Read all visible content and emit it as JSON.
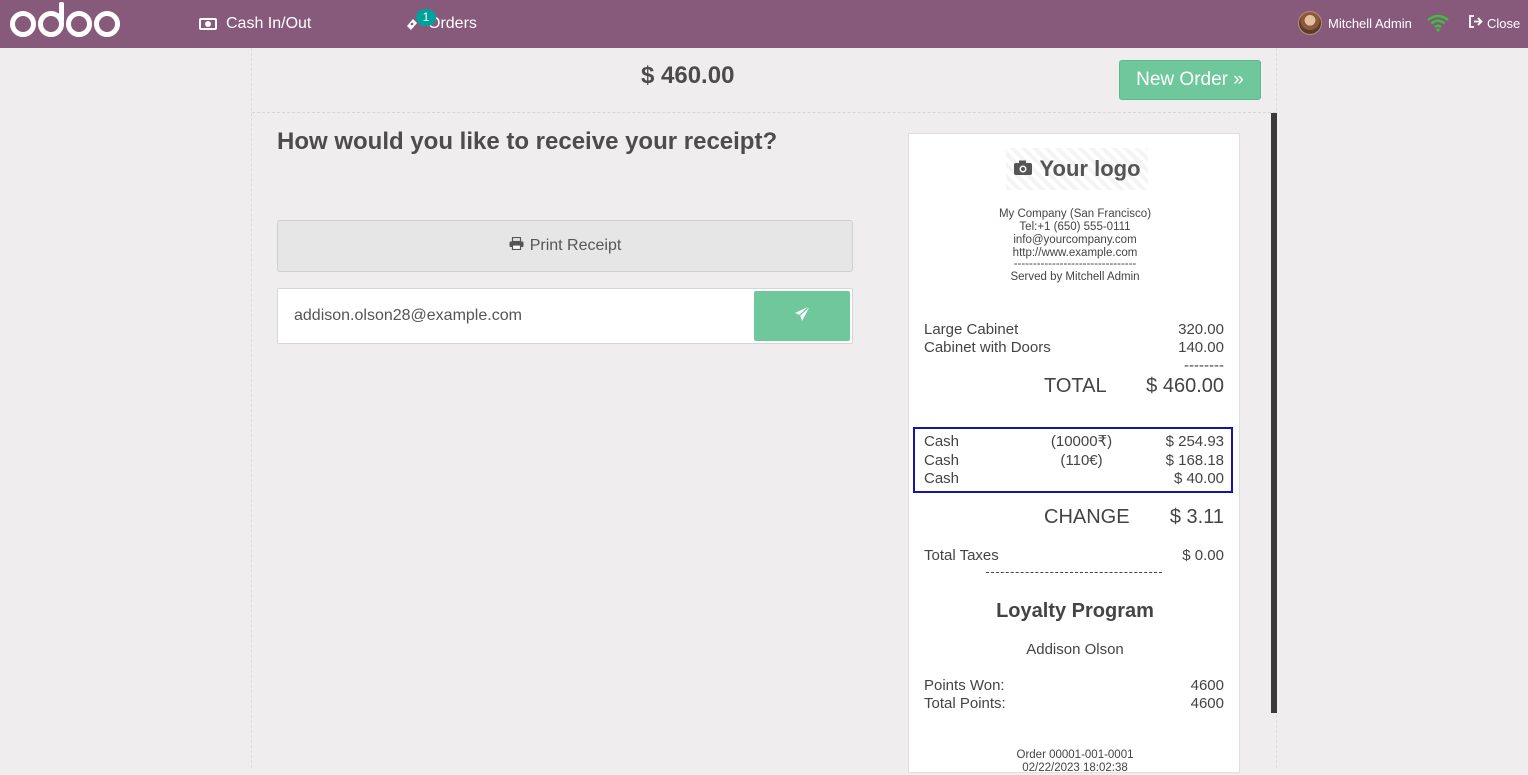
{
  "navbar": {
    "brand": "odoo",
    "cash_label": "Cash In/Out",
    "orders_label": "Orders",
    "orders_badge": "1",
    "user_name": "Mitchell Admin",
    "close_label": "Close"
  },
  "order": {
    "total": "$ 460.00",
    "new_order_label": "New Order »"
  },
  "receipt_options": {
    "question": "How would you like to receive your receipt?",
    "print_label": "Print Receipt",
    "email_value": "addison.olson28@example.com"
  },
  "receipt": {
    "logo_text": "Your logo",
    "company_lines": [
      "My Company (San Francisco)",
      "Tel:+1 (650) 555-0111",
      "info@yourcompany.com",
      "http://www.example.com",
      "--------------------------------",
      "Served by Mitchell Admin"
    ],
    "lines": [
      {
        "name": "Large Cabinet",
        "price": "320.00"
      },
      {
        "name": "Cabinet with Doors",
        "price": "140.00"
      }
    ],
    "separator": "--------",
    "total_label": "TOTAL",
    "total_value": "$ 460.00",
    "payments": [
      {
        "method": "Cash",
        "original": "(10000₹)",
        "amount": "$ 254.93"
      },
      {
        "method": "Cash",
        "original": "(110€)",
        "amount": "$ 168.18"
      },
      {
        "method": "Cash",
        "original": "",
        "amount": "$ 40.00"
      }
    ],
    "change_label": "CHANGE",
    "change_value": "$ 3.11",
    "taxes_label": "Total Taxes",
    "taxes_value": "$ 0.00",
    "loyalty_title": "Loyalty Program",
    "customer_name": "Addison Olson",
    "points_won_label": "Points Won:",
    "points_won_value": "4600",
    "total_points_label": "Total Points:",
    "total_points_value": "4600",
    "order_ref": "Order 00001-001-0001",
    "order_date": "02/22/2023 18:02:38"
  },
  "colors": {
    "navbar": "#875a7b",
    "accent_green": "#6ec89b",
    "badge": "#00a09d",
    "payment_highlight": "#1515a6"
  }
}
